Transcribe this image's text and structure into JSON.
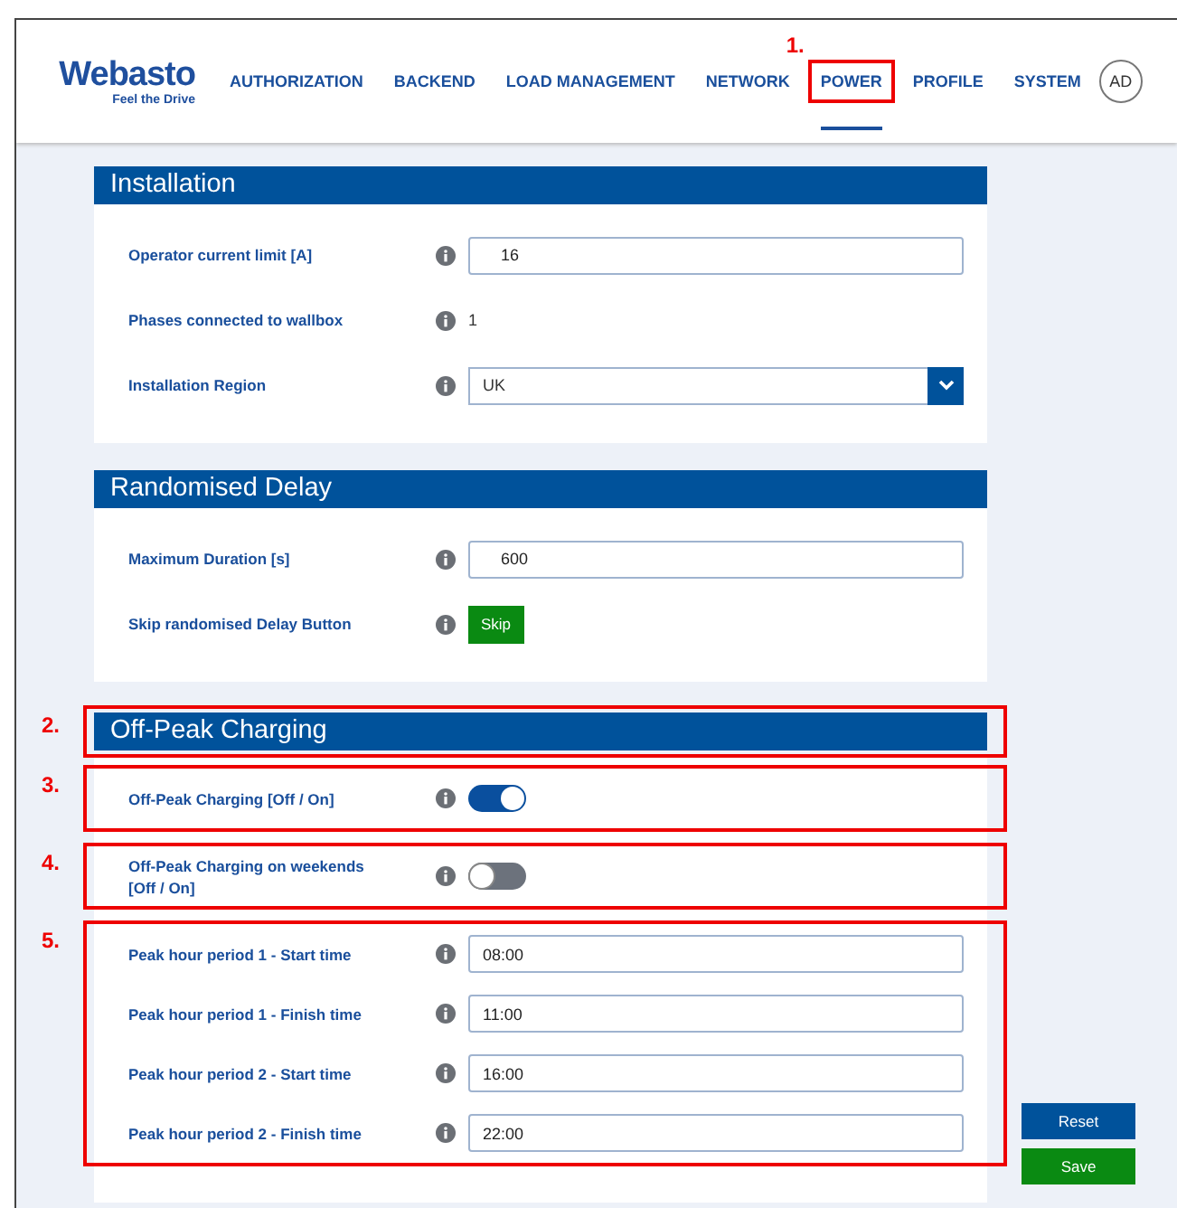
{
  "logo": {
    "name": "Webasto",
    "tagline": "Feel the Drive"
  },
  "tabs": [
    {
      "label": "AUTHORIZATION",
      "selected": false
    },
    {
      "label": "BACKEND",
      "selected": false
    },
    {
      "label": "LOAD MANAGEMENT",
      "selected": false
    },
    {
      "label": "NETWORK",
      "selected": false
    },
    {
      "label": "POWER",
      "selected": true,
      "callout": "1."
    },
    {
      "label": "PROFILE",
      "selected": false
    },
    {
      "label": "SYSTEM",
      "selected": false
    }
  ],
  "user": {
    "initials": "AD"
  },
  "sections": [
    {
      "title": "Installation",
      "groups": [
        {
          "rows": [
            {
              "kind": "input",
              "label": "Operator current limit [A]",
              "value": "16"
            },
            {
              "kind": "text",
              "label": "Phases connected to wallbox",
              "value": "1"
            },
            {
              "kind": "select",
              "label": "Installation Region",
              "value": "UK"
            }
          ]
        }
      ]
    },
    {
      "title": "Randomised Delay",
      "groups": [
        {
          "rows": [
            {
              "kind": "input",
              "label": "Maximum Duration [s]",
              "value": "600"
            },
            {
              "kind": "button",
              "label": "Skip randomised Delay Button",
              "value": "Skip"
            }
          ]
        }
      ]
    },
    {
      "title": "Off-Peak Charging",
      "callout": "2.",
      "groups": [
        {
          "callout": "3.",
          "rows": [
            {
              "kind": "toggle",
              "label": "Off-Peak Charging [Off / On]",
              "on": true
            }
          ]
        },
        {
          "callout": "4.",
          "rows": [
            {
              "kind": "toggle",
              "label": "Off-Peak Charging on weekends [Off / On]",
              "on": false
            }
          ]
        },
        {
          "callout": "5.",
          "rows": [
            {
              "kind": "time",
              "label": "Peak hour period 1 - Start time",
              "value": "08:00"
            },
            {
              "kind": "time",
              "label": "Peak hour period 1 - Finish time",
              "value": "11:00"
            },
            {
              "kind": "time",
              "label": "Peak hour period 2 - Start time",
              "value": "16:00"
            },
            {
              "kind": "time",
              "label": "Peak hour period 2 - Finish time",
              "value": "22:00"
            }
          ]
        }
      ]
    }
  ],
  "actions": [
    {
      "kind": "reset",
      "label": "Reset"
    },
    {
      "kind": "save",
      "label": "Save"
    }
  ]
}
